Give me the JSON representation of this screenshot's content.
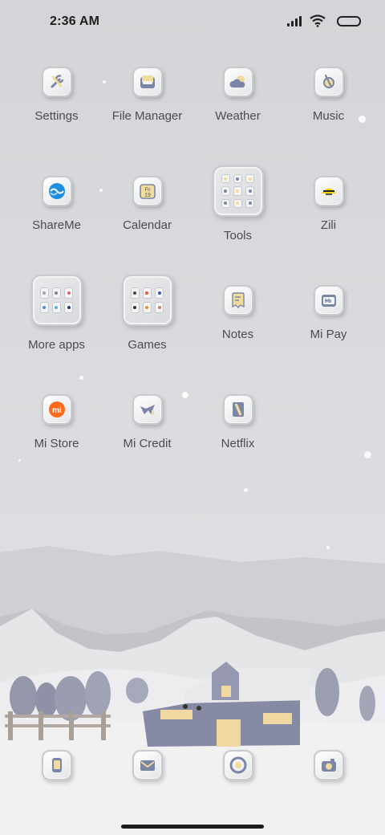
{
  "status_bar": {
    "time": "2:36 AM",
    "icons": [
      "signal-icon",
      "wifi-icon",
      "battery-icon"
    ]
  },
  "apps": [
    {
      "label": "Settings",
      "icon": "settings-icon"
    },
    {
      "label": "File Manager",
      "icon": "file-manager-icon"
    },
    {
      "label": "Weather",
      "icon": "weather-icon"
    },
    {
      "label": "Music",
      "icon": "music-icon"
    },
    {
      "label": "ShareMe",
      "icon": "shareme-icon"
    },
    {
      "label": "Calendar",
      "icon": "calendar-icon",
      "icon_text": [
        "Fri",
        "19"
      ]
    },
    {
      "label": "Tools",
      "icon": "tools-folder-icon"
    },
    {
      "label": "Zili",
      "icon": "zili-icon"
    },
    {
      "label": "More apps",
      "icon": "more-apps-folder-icon"
    },
    {
      "label": "Games",
      "icon": "games-folder-icon"
    },
    {
      "label": "Notes",
      "icon": "notes-icon"
    },
    {
      "label": "Mi Pay",
      "icon": "mi-pay-icon"
    },
    {
      "label": "Mi Store",
      "icon": "mi-store-icon",
      "icon_text": "mi"
    },
    {
      "label": "Mi Credit",
      "icon": "mi-credit-icon"
    },
    {
      "label": "Netflix",
      "icon": "netflix-icon"
    }
  ],
  "dock": [
    {
      "icon": "phone-icon"
    },
    {
      "icon": "messages-icon"
    },
    {
      "icon": "browser-icon"
    },
    {
      "icon": "camera-icon"
    }
  ],
  "colors": {
    "background": "#d6d7da",
    "icon_accent": "#7b86a6",
    "icon_yellow": "#f0dc9c",
    "shareme_blue": "#1e8fe0",
    "mi_orange": "#ff6a1a",
    "zili_yellow": "#f5d20a"
  }
}
